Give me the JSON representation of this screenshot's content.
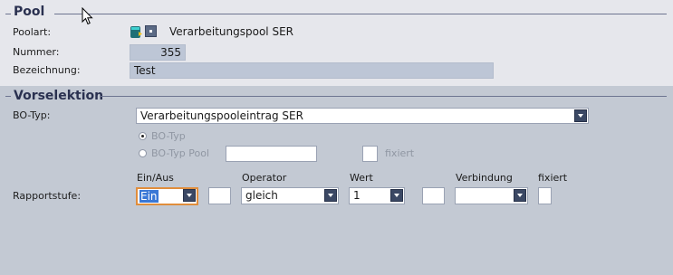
{
  "pool": {
    "title": "Pool",
    "poolart_label": "Poolart:",
    "poolart_value": "Verarbeitungspool SER",
    "nummer_label": "Nummer:",
    "nummer_value": "355",
    "bezeichnung_label": "Bezeichnung:",
    "bezeichnung_value": "Test"
  },
  "vorselektion": {
    "title": "Vorselektion",
    "bo_typ_label": "BO-Typ:",
    "bo_typ_value": "Verarbeitungspooleintrag SER",
    "radio_bo_typ": "BO-Typ",
    "radio_bo_typ_pool": "BO-Typ Pool",
    "fixiert_label": "fixiert",
    "columns": {
      "ein_aus": "Ein/Aus",
      "operator": "Operator",
      "wert": "Wert",
      "verbindung": "Verbindung",
      "fixiert": "fixiert"
    },
    "rapportstufe_label": "Rapportstufe:",
    "row": {
      "ein_aus": "Ein",
      "operator": "gleich",
      "wert": "1",
      "verbindung": ""
    }
  },
  "icons": [
    "pool-type-icon",
    "small-square-icon",
    "mouse-cursor-icon"
  ]
}
